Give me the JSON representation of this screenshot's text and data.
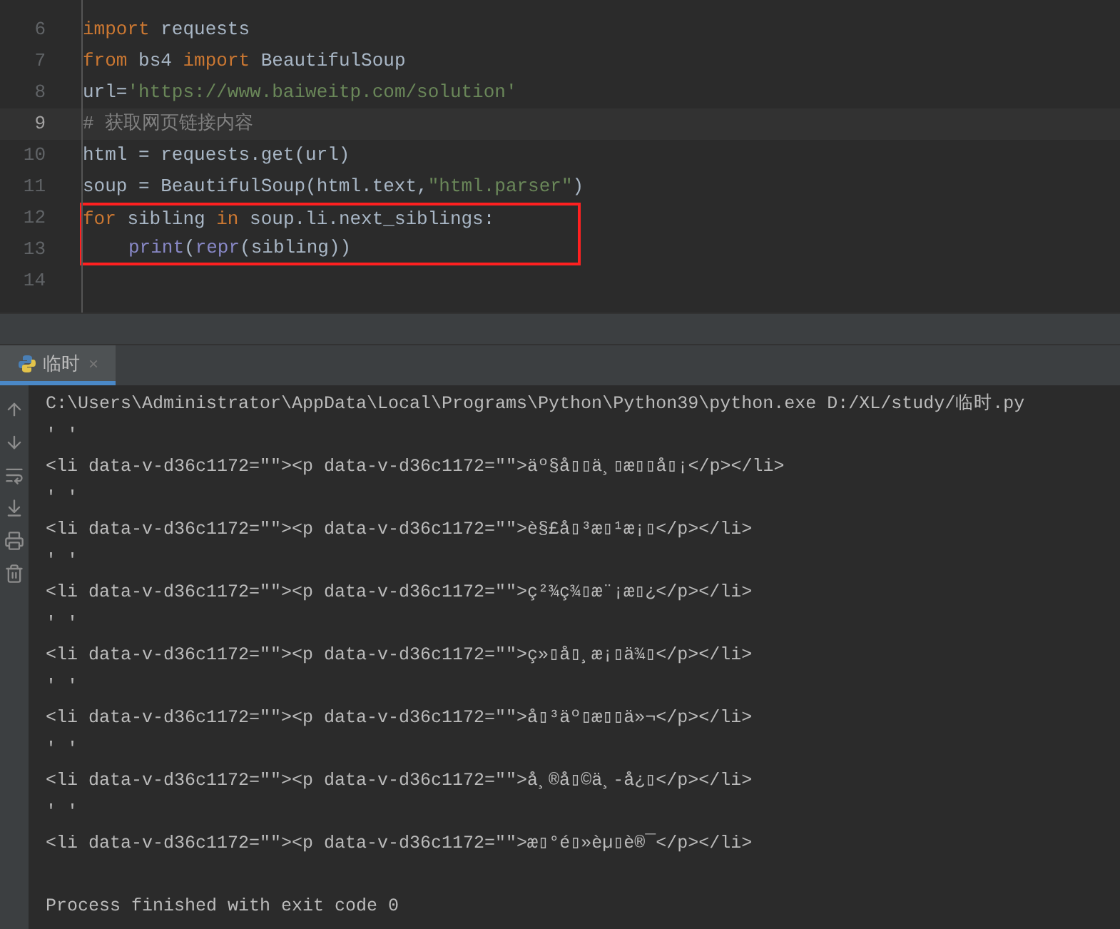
{
  "editor": {
    "lines": [
      {
        "number": "6",
        "current": false,
        "boxed": false,
        "tokens": [
          {
            "text": "import",
            "kind": "keyword"
          },
          {
            "text": " requests",
            "kind": "plain"
          }
        ]
      },
      {
        "number": "7",
        "current": false,
        "boxed": false,
        "tokens": [
          {
            "text": "from",
            "kind": "keyword"
          },
          {
            "text": " bs4 ",
            "kind": "plain"
          },
          {
            "text": "import",
            "kind": "keyword"
          },
          {
            "text": " BeautifulSoup",
            "kind": "plain"
          }
        ]
      },
      {
        "number": "8",
        "current": false,
        "boxed": false,
        "tokens": [
          {
            "text": "url=",
            "kind": "plain"
          },
          {
            "text": "'https://www.baiweitp.com/solution'",
            "kind": "string"
          }
        ]
      },
      {
        "number": "9",
        "current": true,
        "boxed": false,
        "tokens": [
          {
            "text": "# 获取网页链接内容",
            "kind": "comment"
          }
        ]
      },
      {
        "number": "10",
        "current": false,
        "boxed": false,
        "tokens": [
          {
            "text": "html = requests.get(url)",
            "kind": "plain"
          }
        ]
      },
      {
        "number": "11",
        "current": false,
        "boxed": false,
        "tokens": [
          {
            "text": "soup = BeautifulSoup(html.text,",
            "kind": "plain"
          },
          {
            "text": "\"html.parser\"",
            "kind": "string"
          },
          {
            "text": ")",
            "kind": "plain"
          }
        ]
      },
      {
        "number": "12",
        "current": false,
        "boxed": true,
        "tokens": [
          {
            "text": "for",
            "kind": "keyword"
          },
          {
            "text": " sibling ",
            "kind": "plain"
          },
          {
            "text": "in",
            "kind": "keyword"
          },
          {
            "text": " soup.li.next_siblings:",
            "kind": "plain"
          }
        ]
      },
      {
        "number": "13",
        "current": false,
        "boxed": true,
        "indent": true,
        "tokens": [
          {
            "text": "print",
            "kind": "builtin"
          },
          {
            "text": "(",
            "kind": "plain"
          },
          {
            "text": "repr",
            "kind": "builtin"
          },
          {
            "text": "(sibling))",
            "kind": "plain"
          }
        ]
      },
      {
        "number": "14",
        "current": false,
        "boxed": false
      }
    ]
  },
  "run_panel": {
    "tab": {
      "label": "临时",
      "close": "×",
      "selected": true
    },
    "lines": [
      "C:\\Users\\Administrator\\AppData\\Local\\Programs\\Python\\Python39\\python.exe D:/XL/study/临时.py",
      "' '",
      "<li data-v-d36c1172=\"\"><p data-v-d36c1172=\"\">äº§å▯▯ä¸▯æ▯▯å▯¡</p></li>",
      "' '",
      "<li data-v-d36c1172=\"\"><p data-v-d36c1172=\"\">è§£å▯³æ▯¹æ¡▯</p></li>",
      "' '",
      "<li data-v-d36c1172=\"\"><p data-v-d36c1172=\"\">ç²¾ç¾▯æ¨¡æ▯¿</p></li>",
      "' '",
      "<li data-v-d36c1172=\"\"><p data-v-d36c1172=\"\">ç»▯å▯¸æ¡▯ä¾▯</p></li>",
      "' '",
      "<li data-v-d36c1172=\"\"><p data-v-d36c1172=\"\">å▯³äº▯æ▯▯ä»¬</p></li>",
      "' '",
      "<li data-v-d36c1172=\"\"><p data-v-d36c1172=\"\">å¸®å▯©ä¸-å¿▯</p></li>",
      "' '",
      "<li data-v-d36c1172=\"\"><p data-v-d36c1172=\"\">æ▯°é▯»èµ▯è®¯</p></li>"
    ],
    "exit_message": "Process finished with exit code 0"
  }
}
